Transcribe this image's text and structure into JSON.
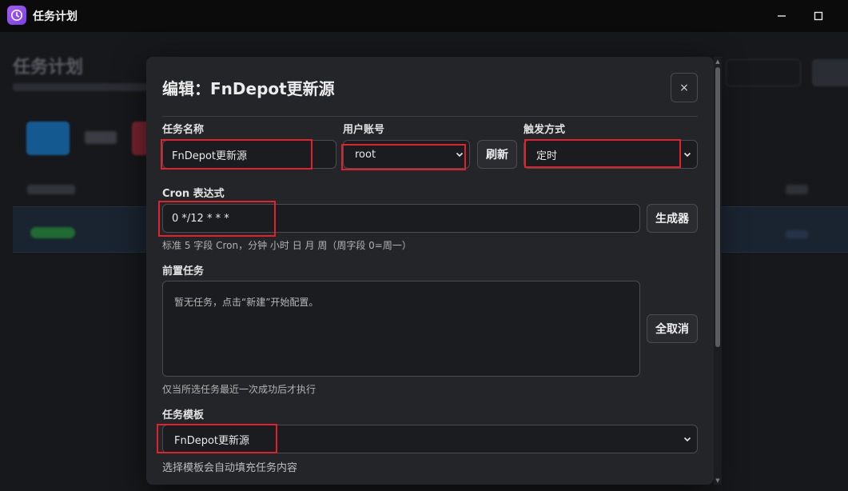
{
  "window": {
    "title": "任务计划"
  },
  "modal": {
    "title": "编辑：FnDepot更新源",
    "close_label": "×",
    "task_name": {
      "label": "任务名称",
      "value": "FnDepot更新源"
    },
    "user_account": {
      "label": "用户账号",
      "value": "root",
      "refresh_label": "刷新"
    },
    "trigger": {
      "label": "触发方式",
      "value": "定时"
    },
    "cron": {
      "label": "Cron 表达式",
      "value": "0 */12 * * *",
      "generator_label": "生成器",
      "help": "标准 5 字段 Cron，分钟 小时 日 月 周（周字段 0=周一）"
    },
    "pre_tasks": {
      "label": "前置任务",
      "empty_text": "暂无任务，点击“新建”开始配置。",
      "deselect_all_label": "全取消",
      "help": "仅当所选任务最近一次成功后才执行"
    },
    "template": {
      "label": "任务模板",
      "value": "FnDepot更新源",
      "help": "选择模板会自动填充任务内容"
    }
  },
  "colors": {
    "accent": "#a55cf7",
    "highlight": "#e0222b"
  }
}
